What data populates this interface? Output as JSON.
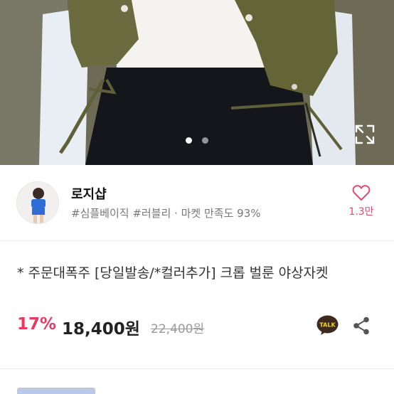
{
  "hero": {
    "slide_count": 2,
    "active_slide": 1
  },
  "shop": {
    "name": "로지샵",
    "tags": "#심플베이직 #러블리 · 마켓 만족도 93%",
    "like_count": "1.3만"
  },
  "product": {
    "title": "* 주문대폭주 [당일발송/*컬러추가] 크롭 벌룬 야상자켓",
    "discount": "17%",
    "price": "18,400원",
    "original_price": "22,400원"
  },
  "icons": {
    "expand": "expand-icon",
    "like": "heart-icon",
    "talk": "kakaotalk-icon",
    "share": "share-icon",
    "talk_label": "TALK"
  },
  "colors": {
    "accent": "#e8395e",
    "talk_bg": "#3c2a1e"
  }
}
